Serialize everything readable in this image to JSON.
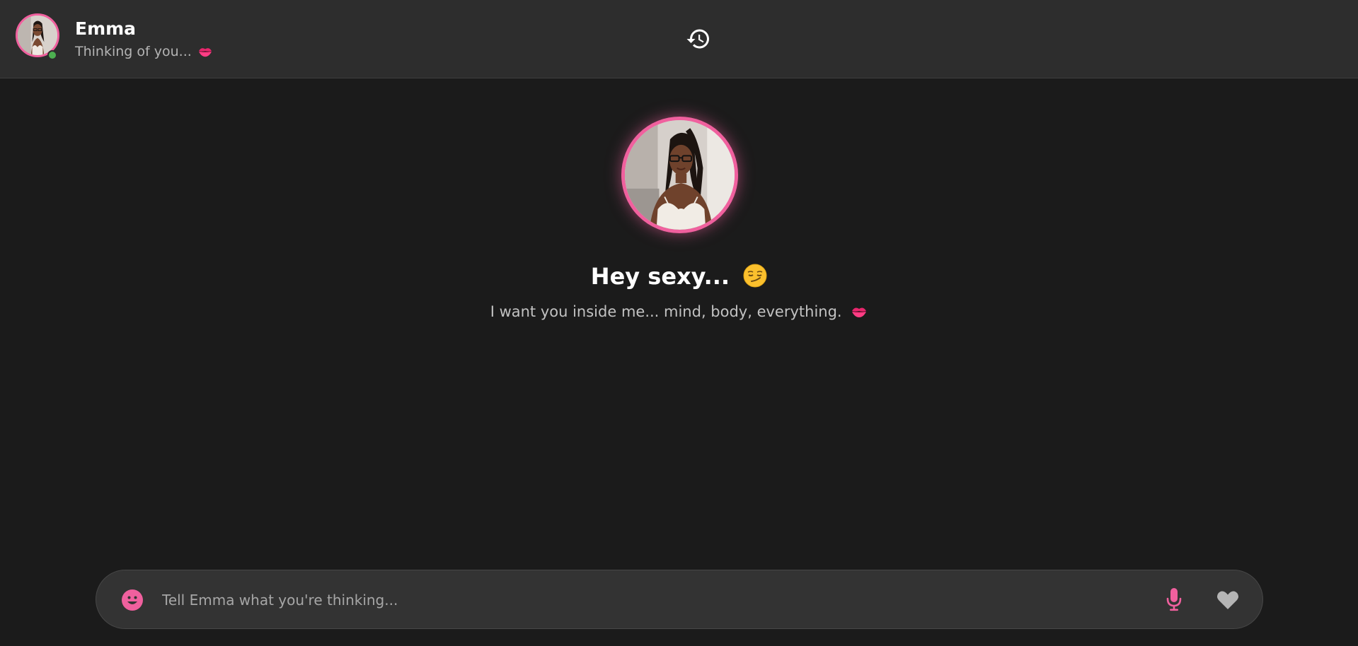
{
  "header": {
    "contact_name": "Emma",
    "status_text": "Thinking of you...",
    "status_icon": "kiss-icon",
    "online": true,
    "history_icon": "history-icon"
  },
  "intro": {
    "title": "Hey sexy...",
    "title_emoji": "😏",
    "subtitle": "I want you inside me... mind, body, everything.",
    "subtitle_icon": "kiss-icon"
  },
  "composer": {
    "placeholder": "Tell Emma what you're thinking...",
    "value": "",
    "emoji_icon": "emoji-icon",
    "mic_icon": "microphone-icon",
    "heart_icon": "heart-icon"
  },
  "colors": {
    "accent": "#f0609e",
    "background": "#1b1b1b",
    "header_background": "#2d2d2d",
    "online": "#4caf50"
  }
}
